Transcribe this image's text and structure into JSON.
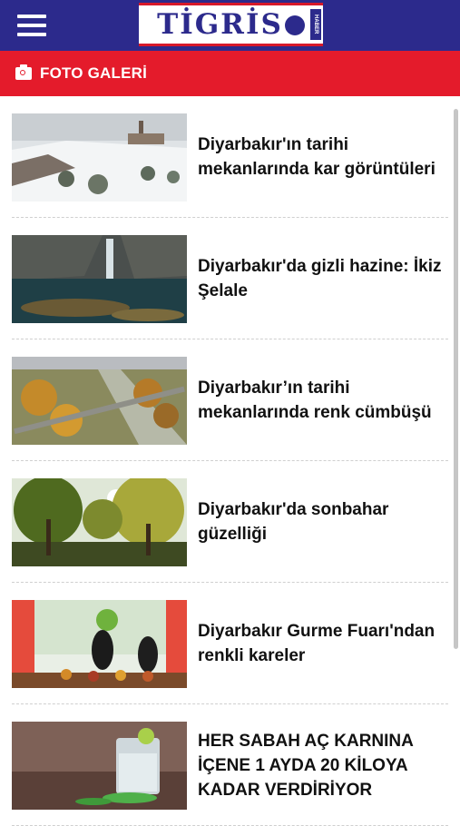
{
  "header": {
    "menu_icon": "hamburger-menu-icon",
    "logo": {
      "name": "TİGRİS",
      "tagline": "HABER"
    },
    "colors": {
      "brand": "#2c2a8c",
      "accent": "#e41b2b"
    }
  },
  "section": {
    "icon": "camera-icon",
    "title": "FOTO GALERİ"
  },
  "items": [
    {
      "title": "Diyarbakır'ın tarihi mekanlarında kar görüntüleri",
      "thumb": "snow-landscape"
    },
    {
      "title": "Diyarbakır'da gizli hazine: İkiz Şelale",
      "thumb": "waterfall"
    },
    {
      "title": "Diyarbakır’ın tarihi mekanlarında renk cümbüşü",
      "thumb": "bridge-autumn"
    },
    {
      "title": "Diyarbakır'da sonbahar güzelliği",
      "thumb": "autumn-trees"
    },
    {
      "title": "Diyarbakır Gurme Fuarı'ndan renkli kareler",
      "thumb": "food-fair"
    },
    {
      "title": "HER SABAH AÇ KARNINA İÇENE 1 AYDA 20 KİLOYA KADAR VERDİRİYOR",
      "thumb": "lime-water-glass"
    }
  ]
}
